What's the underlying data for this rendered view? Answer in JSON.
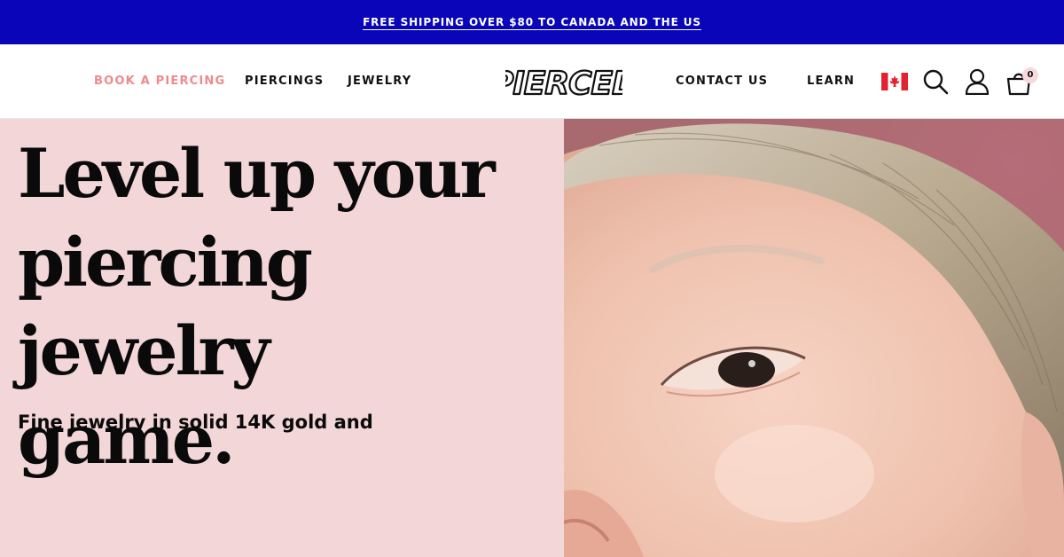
{
  "announcement": {
    "text": "FREE SHIPPING OVER $80 TO CANADA AND THE US"
  },
  "nav": {
    "book": "BOOK A PIERCING",
    "piercings": "PIERCINGS",
    "jewelry": "JEWELRY",
    "contact": "CONTACT US",
    "learn": "LEARN",
    "logo": "PIERCED",
    "cart_count": "0"
  },
  "icons": {
    "flag": "canada-flag-icon",
    "search": "search-icon",
    "account": "user-icon",
    "cart": "shopping-bag-icon"
  },
  "colors": {
    "announcement_bg": "#0a05b8",
    "accent": "#ef8a8c",
    "hero_bg": "#f2d6d8"
  },
  "hero": {
    "headline_1": "Level up your",
    "headline_2": "piercing jewelry",
    "headline_3": "game.",
    "subtext": "Fine jewelry in solid 14K gold and"
  }
}
